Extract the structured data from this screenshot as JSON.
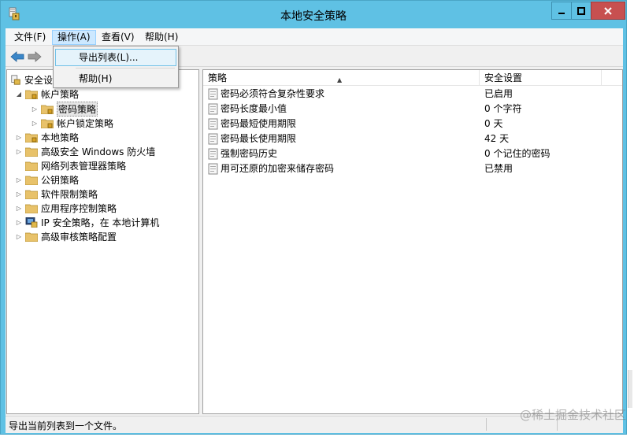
{
  "window": {
    "title": "本地安全策略",
    "controls": {
      "minimize": "—",
      "maximize": "□",
      "close": "✕"
    }
  },
  "menubar": {
    "items": [
      {
        "label": "文件(F)"
      },
      {
        "label": "操作(A)"
      },
      {
        "label": "查看(V)"
      },
      {
        "label": "帮助(H)"
      }
    ]
  },
  "dropdown": {
    "items": [
      {
        "label": "导出列表(L)..."
      },
      {
        "label": "帮助(H)"
      }
    ]
  },
  "tree": {
    "items": [
      {
        "label": "安全设置"
      },
      {
        "label": "帐户策略"
      },
      {
        "label": "密码策略"
      },
      {
        "label": "帐户锁定策略"
      },
      {
        "label": "本地策略"
      },
      {
        "label": "高级安全 Windows 防火墙"
      },
      {
        "label": "网络列表管理器策略"
      },
      {
        "label": "公钥策略"
      },
      {
        "label": "软件限制策略"
      },
      {
        "label": "应用程序控制策略"
      },
      {
        "label": "IP 安全策略，在 本地计算机"
      },
      {
        "label": "高级审核策略配置"
      }
    ]
  },
  "list": {
    "columns": {
      "policy": "策略",
      "setting": "安全设置"
    },
    "rows": [
      {
        "policy": "密码必须符合复杂性要求",
        "setting": "已启用"
      },
      {
        "policy": "密码长度最小值",
        "setting": "0 个字符"
      },
      {
        "policy": "密码最短使用期限",
        "setting": "0 天"
      },
      {
        "policy": "密码最长使用期限",
        "setting": "42 天"
      },
      {
        "policy": "强制密码历史",
        "setting": "0 个记住的密码"
      },
      {
        "policy": "用可还原的加密来储存密码",
        "setting": "已禁用"
      }
    ]
  },
  "statusbar": {
    "text": "导出当前列表到一个文件。"
  },
  "watermark": {
    "text": "@稀土掘金技术社区"
  },
  "colors": {
    "titlebar": "#5fc1e4",
    "close_button": "#c75050",
    "menu_active": "#cce8ff",
    "folder": "#e8c26a",
    "nav_arrow": "#3a86c8"
  }
}
